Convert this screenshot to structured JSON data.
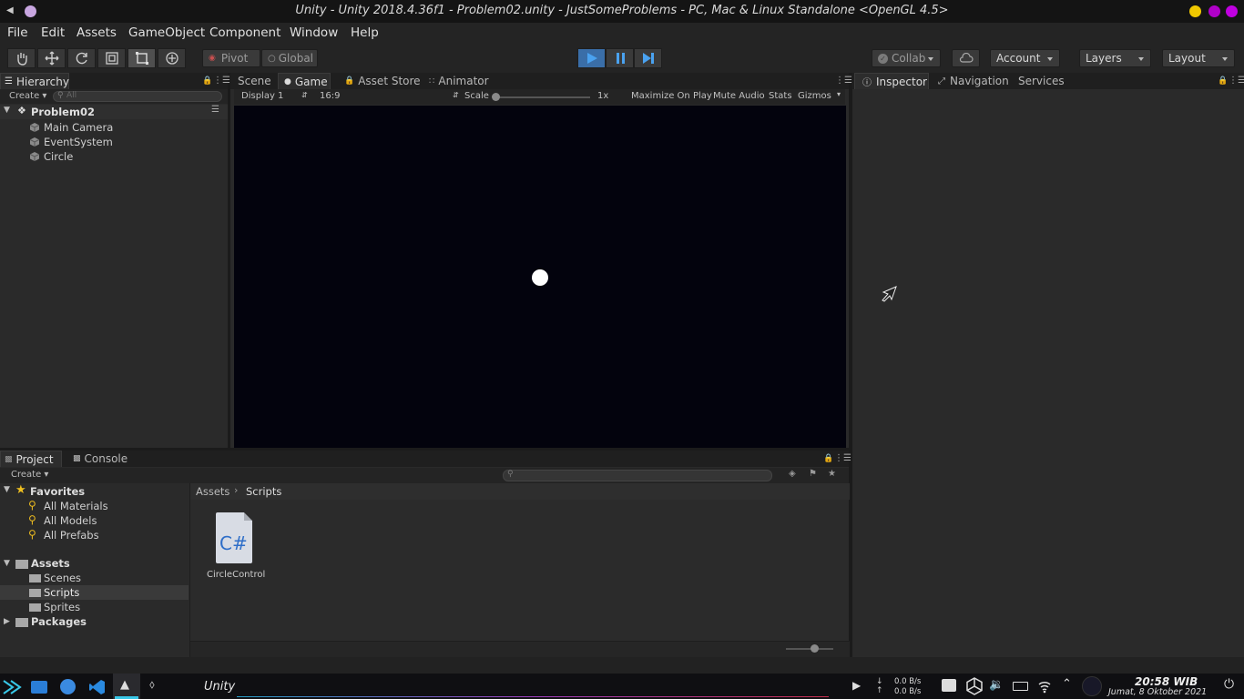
{
  "window": {
    "title": "Unity - Unity 2018.4.36f1 - Problem02.unity - JustSomeProblems - PC, Mac & Linux Standalone <OpenGL 4.5>",
    "dot_colors": [
      "#f0c800",
      "#b000c8",
      "#c000e0"
    ]
  },
  "menu": [
    "File",
    "Edit",
    "Assets",
    "GameObject",
    "Component",
    "Window",
    "Help"
  ],
  "toolbar": {
    "pivot": "Pivot",
    "global": "Global",
    "collab": "Collab",
    "account": "Account",
    "layers": "Layers",
    "layout": "Layout",
    "play_color": "#3a82c8"
  },
  "hierarchy": {
    "tab": "Hierarchy",
    "create": "Create",
    "search_placeholder": "All",
    "scene": "Problem02",
    "items": [
      "Main Camera",
      "EventSystem",
      "Circle"
    ]
  },
  "center_tabs": [
    "Scene",
    "Game",
    "Asset Store",
    "Animator"
  ],
  "game": {
    "display": "Display 1",
    "aspect": "16:9",
    "scale_label": "Scale",
    "scale_value": "1x",
    "maximize": "Maximize On Play",
    "mute": "Mute Audio",
    "stats": "Stats",
    "gizmos": "Gizmos",
    "background": "#03030d"
  },
  "inspector_tabs": [
    "Inspector",
    "Navigation",
    "Services"
  ],
  "project": {
    "tabs": [
      "Project",
      "Console"
    ],
    "create": "Create",
    "favorites": "Favorites",
    "favorite_items": [
      "All Materials",
      "All Models",
      "All Prefabs"
    ],
    "assets": "Assets",
    "asset_folders": [
      "Scenes",
      "Scripts",
      "Sprites"
    ],
    "packages": "Packages",
    "breadcrumb": [
      "Assets",
      "Scripts"
    ],
    "file_icon_text": "C#",
    "file_name": "CircleControl"
  },
  "taskbar": {
    "app": "Unity",
    "net_up": "0.0 B/s",
    "net_down": "0.0 B/s",
    "time": "20:58 WIB",
    "date": "Jumat, 8 Oktober 2021"
  }
}
